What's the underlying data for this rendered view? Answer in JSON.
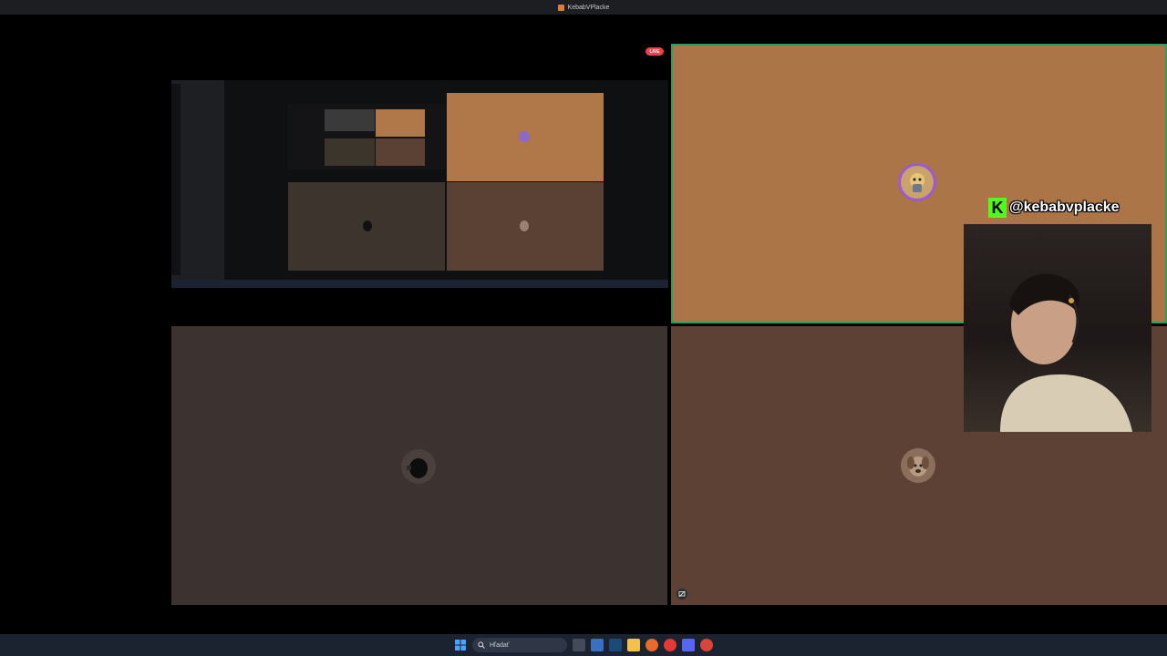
{
  "window": {
    "title": "KebabVPlacke"
  },
  "stream": {
    "live_badge": "LIVE",
    "handle": "@kebabvplacke",
    "kick_logo_letter": "K"
  },
  "taskbar": {
    "search_placeholder": "Hľadať"
  },
  "colors": {
    "speaking_outline": "#2e9c5b",
    "tile_orange": "#ab7548",
    "tile_dark": "#3c3230",
    "tile_brown": "#5d4135",
    "kick_green": "#53fc18",
    "live_red": "#ed4245"
  },
  "icons": [
    "kebab-app-icon",
    "windows-start-icon",
    "search-icon",
    "task-view-icon",
    "store-icon",
    "steam-icon",
    "file-explorer-icon",
    "firefox-icon",
    "youtube-icon",
    "discord-icon",
    "chrome-icon",
    "screenshare-toggle-icon"
  ]
}
